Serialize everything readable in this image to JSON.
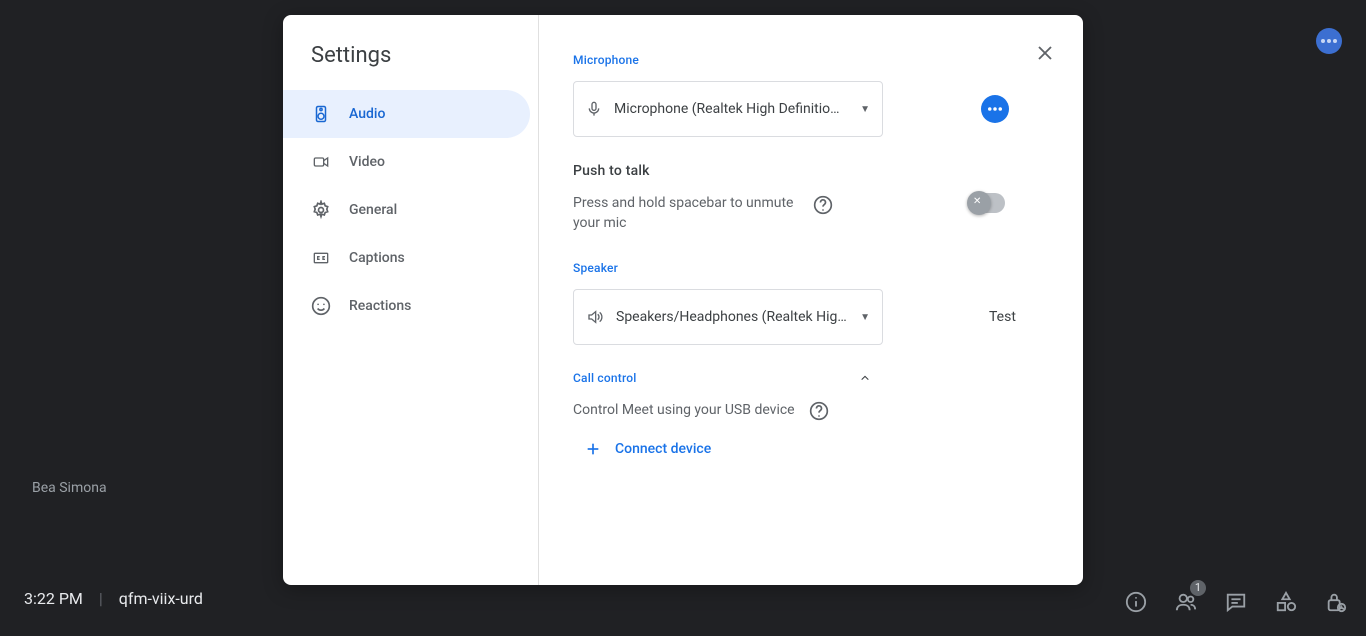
{
  "bg": {
    "participant_name": "Bea Simona",
    "time": "3:22 PM",
    "meeting_code": "qfm-viix-urd",
    "people_badge": "1"
  },
  "dialog": {
    "title": "Settings",
    "tabs": {
      "audio": "Audio",
      "video": "Video",
      "general": "General",
      "captions": "Captions",
      "reactions": "Reactions"
    },
    "audio": {
      "mic_label": "Microphone",
      "mic_value": "Microphone (Realtek High Definitio…",
      "ptt_title": "Push to talk",
      "ptt_desc": "Press and hold spacebar to unmute your mic",
      "speaker_label": "Speaker",
      "speaker_value": "Speakers/Headphones (Realtek Hig…",
      "test_label": "Test",
      "cc_label": "Call control",
      "cc_desc": "Control Meet using your USB device",
      "connect_label": "Connect device"
    }
  }
}
